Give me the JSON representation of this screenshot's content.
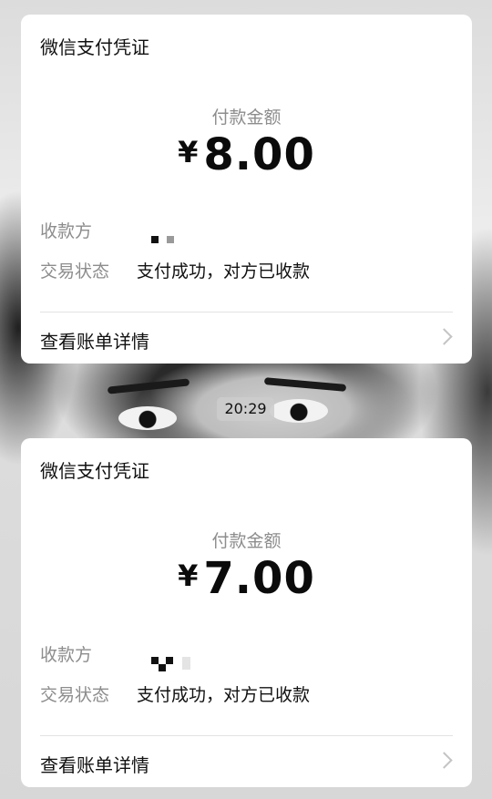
{
  "receipts": [
    {
      "title": "微信支付凭证",
      "amount_label": "付款金额",
      "currency": "¥",
      "amount": "8.00",
      "payee_label": "收款方",
      "status_label": "交易状态",
      "status_value": "支付成功，对方已收款",
      "detail_link": "查看账单详情"
    },
    {
      "title": "微信支付凭证",
      "amount_label": "付款金额",
      "currency": "¥",
      "amount": "7.00",
      "payee_label": "收款方",
      "status_label": "交易状态",
      "status_value": "支付成功，对方已收款",
      "detail_link": "查看账单详情"
    }
  ],
  "timestamp": "20:29",
  "colors": {
    "card_bg": "#ffffff",
    "label_gray": "#8d8d8d",
    "text_dark": "#111111",
    "chevron": "#c4c4c4"
  },
  "icons": {
    "detail_arrow": "chevron-right-icon",
    "payee_avatar": "pixel-avatar-icon"
  }
}
